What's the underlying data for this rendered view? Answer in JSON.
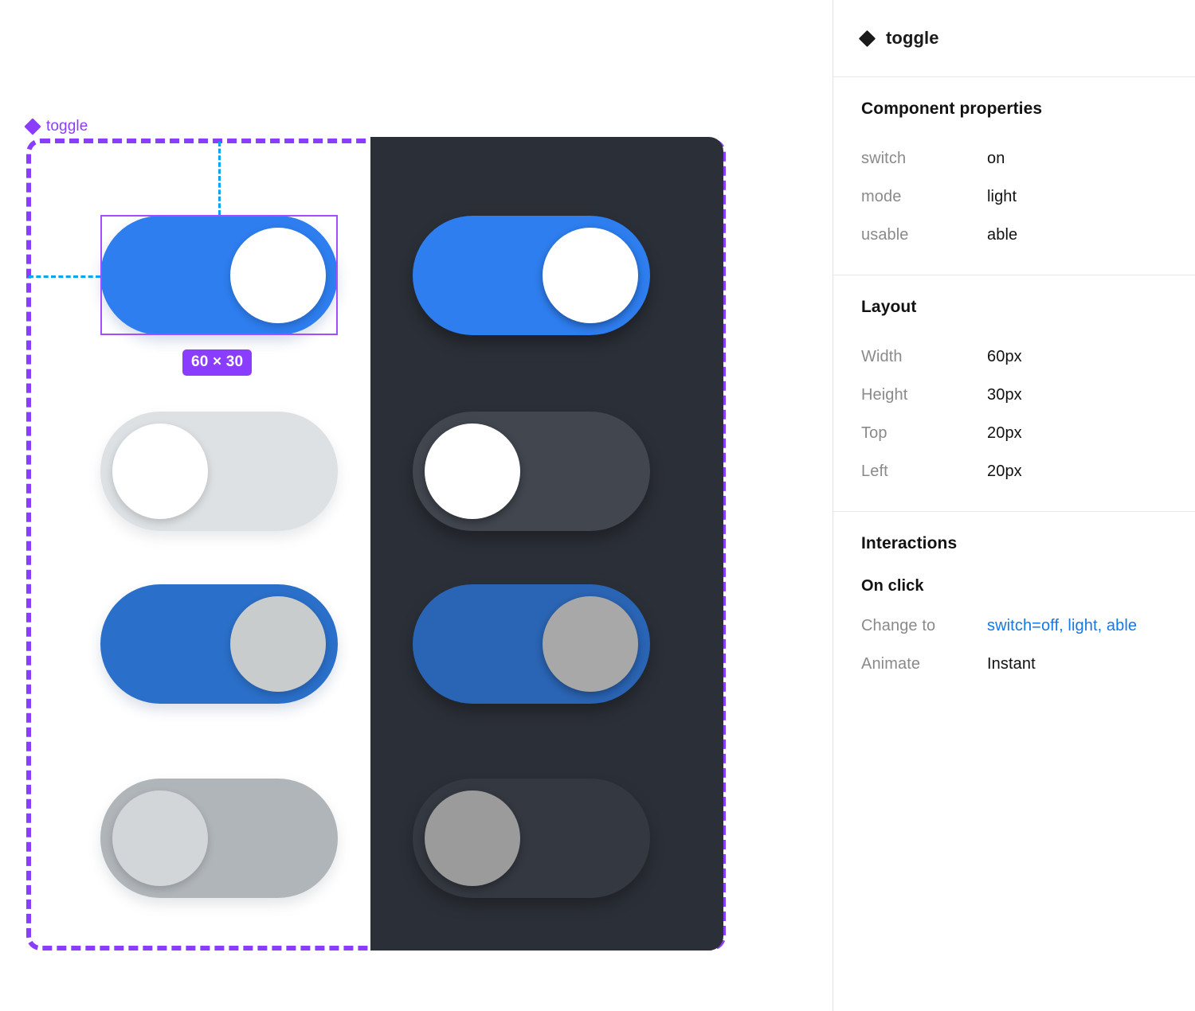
{
  "canvas": {
    "component_label": "toggle",
    "component_label_icon": "component-diamond-icon",
    "size_badge": "60 × 30",
    "frame_color": "#8b3dff",
    "guide_color": "#0aa5f0",
    "dark_panel_bg": "#2b2f37",
    "toggles": [
      {
        "name": "toggle-on-light-able",
        "mode": "light",
        "state": "on",
        "track": "#2e7ef0",
        "knob": "#ffffff"
      },
      {
        "name": "toggle-off-light-able",
        "mode": "light",
        "state": "off",
        "track": "#dde1e4",
        "knob": "#ffffff"
      },
      {
        "name": "toggle-on-light-disabled",
        "mode": "light",
        "state": "on",
        "track": "#2a6fc9",
        "knob": "#c9cccd"
      },
      {
        "name": "toggle-off-light-disabled",
        "mode": "light",
        "state": "off",
        "track": "#b0b5ba",
        "knob": "#d3d6d8"
      },
      {
        "name": "toggle-on-dark-able",
        "mode": "dark",
        "state": "on",
        "track": "#2e7ef0",
        "knob": "#ffffff"
      },
      {
        "name": "toggle-off-dark-able",
        "mode": "dark",
        "state": "off",
        "track": "#41464f",
        "knob": "#ffffff"
      },
      {
        "name": "toggle-on-dark-disabled",
        "mode": "dark",
        "state": "on",
        "track": "#2a64b4",
        "knob": "#a8a8a8"
      },
      {
        "name": "toggle-off-dark-disabled",
        "mode": "dark",
        "state": "off",
        "track": "#343840",
        "knob": "#9b9b9b"
      }
    ]
  },
  "inspector": {
    "header": {
      "icon": "component-diamond-icon",
      "title": "toggle"
    },
    "component_properties": {
      "heading": "Component properties",
      "rows": [
        {
          "key": "switch",
          "value": "on"
        },
        {
          "key": "mode",
          "value": "light"
        },
        {
          "key": "usable",
          "value": "able"
        }
      ]
    },
    "layout": {
      "heading": "Layout",
      "rows": [
        {
          "key": "Width",
          "value": "60px"
        },
        {
          "key": "Height",
          "value": "30px"
        },
        {
          "key": "Top",
          "value": "20px"
        },
        {
          "key": "Left",
          "value": "20px"
        }
      ]
    },
    "interactions": {
      "heading": "Interactions",
      "trigger": "On click",
      "rows": [
        {
          "key": "Change to",
          "value": "switch=off, light, able",
          "link": true
        },
        {
          "key": "Animate",
          "value": "Instant",
          "link": false
        }
      ]
    },
    "link_color": "#1378e8"
  }
}
